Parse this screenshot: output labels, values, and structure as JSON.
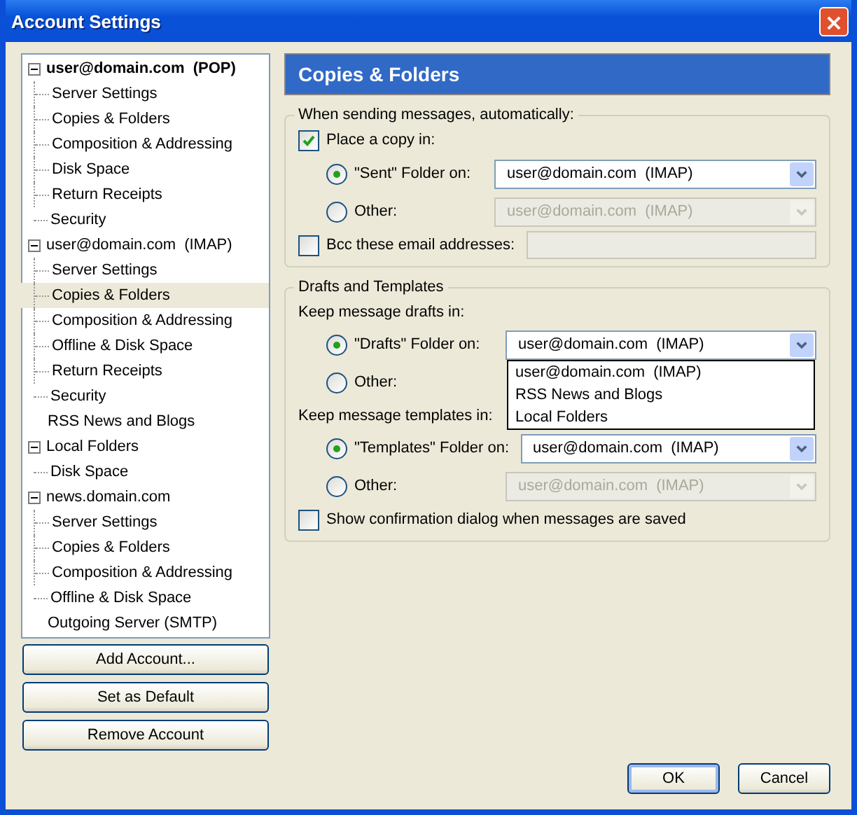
{
  "window": {
    "title": "Account Settings"
  },
  "tree": [
    {
      "label": "user@domain.com  (POP)",
      "default": true,
      "expanded": true,
      "selected": false,
      "children": [
        {
          "label": "Server Settings",
          "selected": false
        },
        {
          "label": "Copies & Folders",
          "selected": false
        },
        {
          "label": "Composition & Addressing",
          "selected": false
        },
        {
          "label": "Disk Space",
          "selected": false
        },
        {
          "label": "Return Receipts",
          "selected": false
        },
        {
          "label": "Security",
          "selected": false
        }
      ]
    },
    {
      "label": "user@domain.com  (IMAP)",
      "default": false,
      "expanded": true,
      "selected": false,
      "children": [
        {
          "label": "Server Settings",
          "selected": false
        },
        {
          "label": "Copies & Folders",
          "selected": true
        },
        {
          "label": "Composition & Addressing",
          "selected": false
        },
        {
          "label": "Offline & Disk Space",
          "selected": false
        },
        {
          "label": "Return Receipts",
          "selected": false
        },
        {
          "label": "Security",
          "selected": false
        }
      ]
    },
    {
      "label": "RSS News and Blogs",
      "default": false,
      "selected": false
    },
    {
      "label": "Local Folders",
      "default": false,
      "expanded": true,
      "selected": false,
      "children": [
        {
          "label": "Disk Space",
          "selected": false
        }
      ]
    },
    {
      "label": "news.domain.com",
      "default": false,
      "expanded": true,
      "selected": false,
      "children": [
        {
          "label": "Server Settings",
          "selected": false
        },
        {
          "label": "Copies & Folders",
          "selected": false
        },
        {
          "label": "Composition & Addressing",
          "selected": false
        },
        {
          "label": "Offline & Disk Space",
          "selected": false
        }
      ]
    },
    {
      "label": "Outgoing Server (SMTP)",
      "default": false,
      "selected": false
    }
  ],
  "account_buttons": [
    {
      "label": "Add Account..."
    },
    {
      "label": "Set as Default"
    },
    {
      "label": "Remove Account"
    }
  ],
  "panel": {
    "title": "Copies & Folders"
  },
  "sending": {
    "legend": "When sending messages, automatically:",
    "place_copy": {
      "label": "Place a copy in:",
      "checked": true
    },
    "options": [
      {
        "label": "\"Sent\" Folder on:",
        "selected": true,
        "select": {
          "value": "user@domain.com  (IMAP)",
          "disabled": false
        }
      },
      {
        "label": "Other:",
        "selected": false,
        "select": {
          "value": "user@domain.com  (IMAP)",
          "disabled": true
        }
      }
    ],
    "bcc": {
      "label": "Bcc these email addresses:",
      "checked": false,
      "field_disabled": true
    }
  },
  "drafts_templates": {
    "legend": "Drafts and Templates",
    "groups": [
      {
        "heading": "Keep message drafts in:",
        "options": [
          {
            "label": "\"Drafts\" Folder on:",
            "selected": true,
            "select": {
              "value": "user@domain.com  (IMAP)",
              "disabled": false,
              "open_items": [
                "user@domain.com  (IMAP)",
                "RSS News and Blogs",
                "Local Folders"
              ]
            }
          },
          {
            "label": "Other:",
            "selected": false
          }
        ]
      },
      {
        "heading": "Keep message templates in:",
        "options": [
          {
            "label": "\"Templates\" Folder on:",
            "selected": true,
            "select": {
              "value": "user@domain.com  (IMAP)",
              "disabled": false
            }
          },
          {
            "label": "Other:",
            "selected": false,
            "select": {
              "value": "user@domain.com  (IMAP)",
              "disabled": true
            }
          }
        ]
      }
    ],
    "confirm": {
      "label": "Show confirmation dialog when messages are saved",
      "checked": false
    }
  },
  "dialog_buttons": [
    {
      "label": "OK",
      "default": true
    },
    {
      "label": "Cancel",
      "default": false
    }
  ]
}
